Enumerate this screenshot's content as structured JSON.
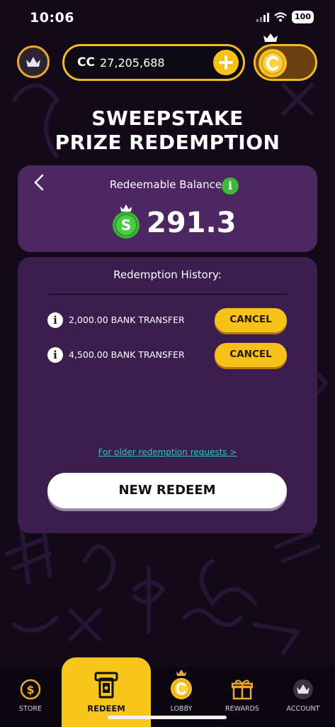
{
  "status": {
    "time": "10:06",
    "battery": "100"
  },
  "header": {
    "currency_label": "CC",
    "currency_value": "27,205,688"
  },
  "title": {
    "line1": "SWEEPSTAKE",
    "line2": "PRIZE REDEMPTION"
  },
  "balance": {
    "label": "Redeemable Balance:",
    "value": "291.3",
    "info_glyph": "i",
    "coin_glyph": "S"
  },
  "history": {
    "title": "Redemption History:",
    "rows": [
      {
        "text": "2,000.00 BANK TRANSFER",
        "action": "CANCEL",
        "info_glyph": "i"
      },
      {
        "text": "4,500.00 BANK TRANSFER",
        "action": "CANCEL",
        "info_glyph": "i"
      }
    ],
    "older_link": "For older redemption requests >",
    "new_redeem": "NEW REDEEM"
  },
  "nav": {
    "items": [
      {
        "label": "STORE",
        "icon": "dollar-coin-icon"
      },
      {
        "label": "REDEEM",
        "icon": "redeem-atm-icon",
        "active": true
      },
      {
        "label": "LOBBY",
        "icon": "crown-coin-icon"
      },
      {
        "label": "REWARDS",
        "icon": "gift-icon"
      },
      {
        "label": "ACCOUNT",
        "icon": "crown-avatar-icon"
      }
    ]
  },
  "colors": {
    "background": "#120a18",
    "card_primary": "#4d2761",
    "card_secondary": "#3b1d4f",
    "accent_yellow": "#f6c21a",
    "link_teal": "#2ec4b6",
    "sweeps_green": "#3fb839"
  }
}
